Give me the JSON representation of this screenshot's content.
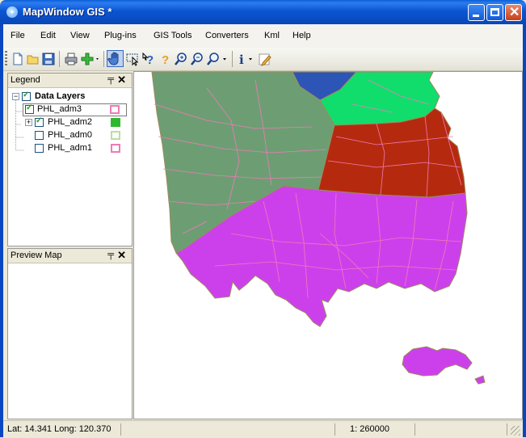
{
  "window": {
    "title": "MapWindow GIS *",
    "icon": "globe-icon"
  },
  "menu": [
    "File",
    "Edit",
    "View",
    "Plug-ins",
    "GIS Tools",
    "Converters",
    "Kml",
    "Help"
  ],
  "toolbar": {
    "icons": [
      "new-document-icon",
      "open-folder-icon",
      "save-icon",
      "print-icon",
      "add-layer-icon",
      "pan-hand-icon",
      "select-icon",
      "identify-icon",
      "help-icon",
      "zoom-in-icon",
      "zoom-out-icon",
      "zoom-extent-icon",
      "info-icon",
      "edit-icon"
    ]
  },
  "legend": {
    "title": "Legend",
    "pin": "ᵖ",
    "close": "✕",
    "group": "Data Layers",
    "layers": [
      {
        "name": "PHL_adm3",
        "checked": true,
        "color": "#f07ab8"
      },
      {
        "name": "PHL_adm2",
        "checked": true,
        "color": "#2fb82f"
      },
      {
        "name": "PHL_adm0",
        "checked": false,
        "color": "#b8e0a0"
      },
      {
        "name": "PHL_adm1",
        "checked": false,
        "color": "#f07ab8"
      }
    ]
  },
  "preview": {
    "title": "Preview Map",
    "pin": "ᵖ",
    "close": "✕"
  },
  "map": {
    "colors": {
      "green": "#6d9e73",
      "blue": "#2c55b5",
      "light_green": "#11dd6c",
      "red": "#b52a0e",
      "purple": "#cc40ec",
      "border": "#f07ab8"
    }
  },
  "status": {
    "coords": "Lat: 14.341 Long: 120.370",
    "scale": "1: 260000"
  }
}
